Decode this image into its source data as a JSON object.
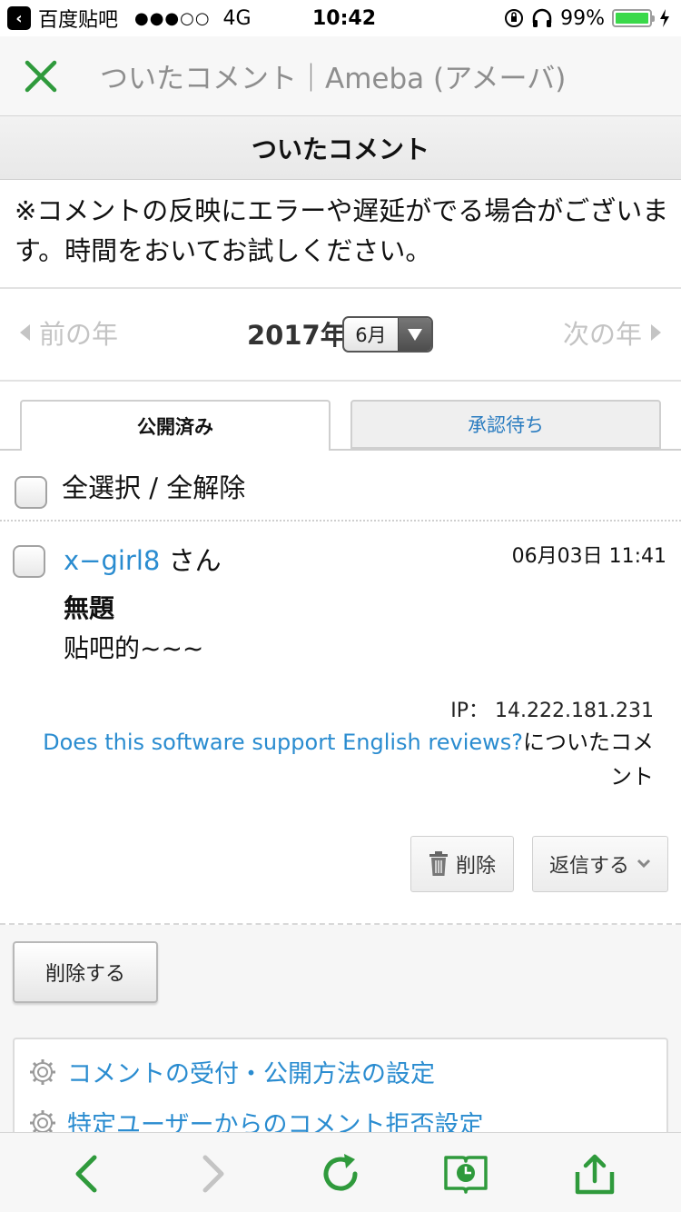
{
  "status_bar": {
    "app_name": "百度贴吧",
    "signal": "●●●○○",
    "network": "4G",
    "time": "10:42",
    "battery": "99%",
    "battery_level": 0.99
  },
  "browser": {
    "page_title": "ついたコメント｜Ameba (アメーバ)"
  },
  "section_title": "ついたコメント",
  "notice": "※コメントの反映にエラーや遅延がでる場合がございます。時間をおいてお試しください。",
  "year_nav": {
    "prev_label": "前の年",
    "year": "2017年",
    "month": "6月",
    "next_label": "次の年"
  },
  "tabs": [
    {
      "label": "公開済み"
    },
    {
      "label": "承認待ち"
    }
  ],
  "select_all_label": "全選択 / 全解除",
  "comment": {
    "author": "x−girl8",
    "author_suffix": "さん",
    "date": "06月03日 11:41",
    "title": "無題",
    "body": "贴吧的~~~",
    "ip": "IP：  14.222.181.231",
    "ref_link": "Does this software support English reviews?",
    "ref_suffix": "についたコメント",
    "delete_label": "削除",
    "reply_label": "返信する"
  },
  "delete_selected_label": "削除する",
  "settings_links": [
    {
      "label": "コメントの受付・公開方法の設定"
    },
    {
      "label": "特定ユーザーからのコメント拒否設定"
    }
  ],
  "colors": {
    "link": "#2a8cd0",
    "accent_green": "#2f9a3c",
    "disabled": "#c4c4c4"
  }
}
